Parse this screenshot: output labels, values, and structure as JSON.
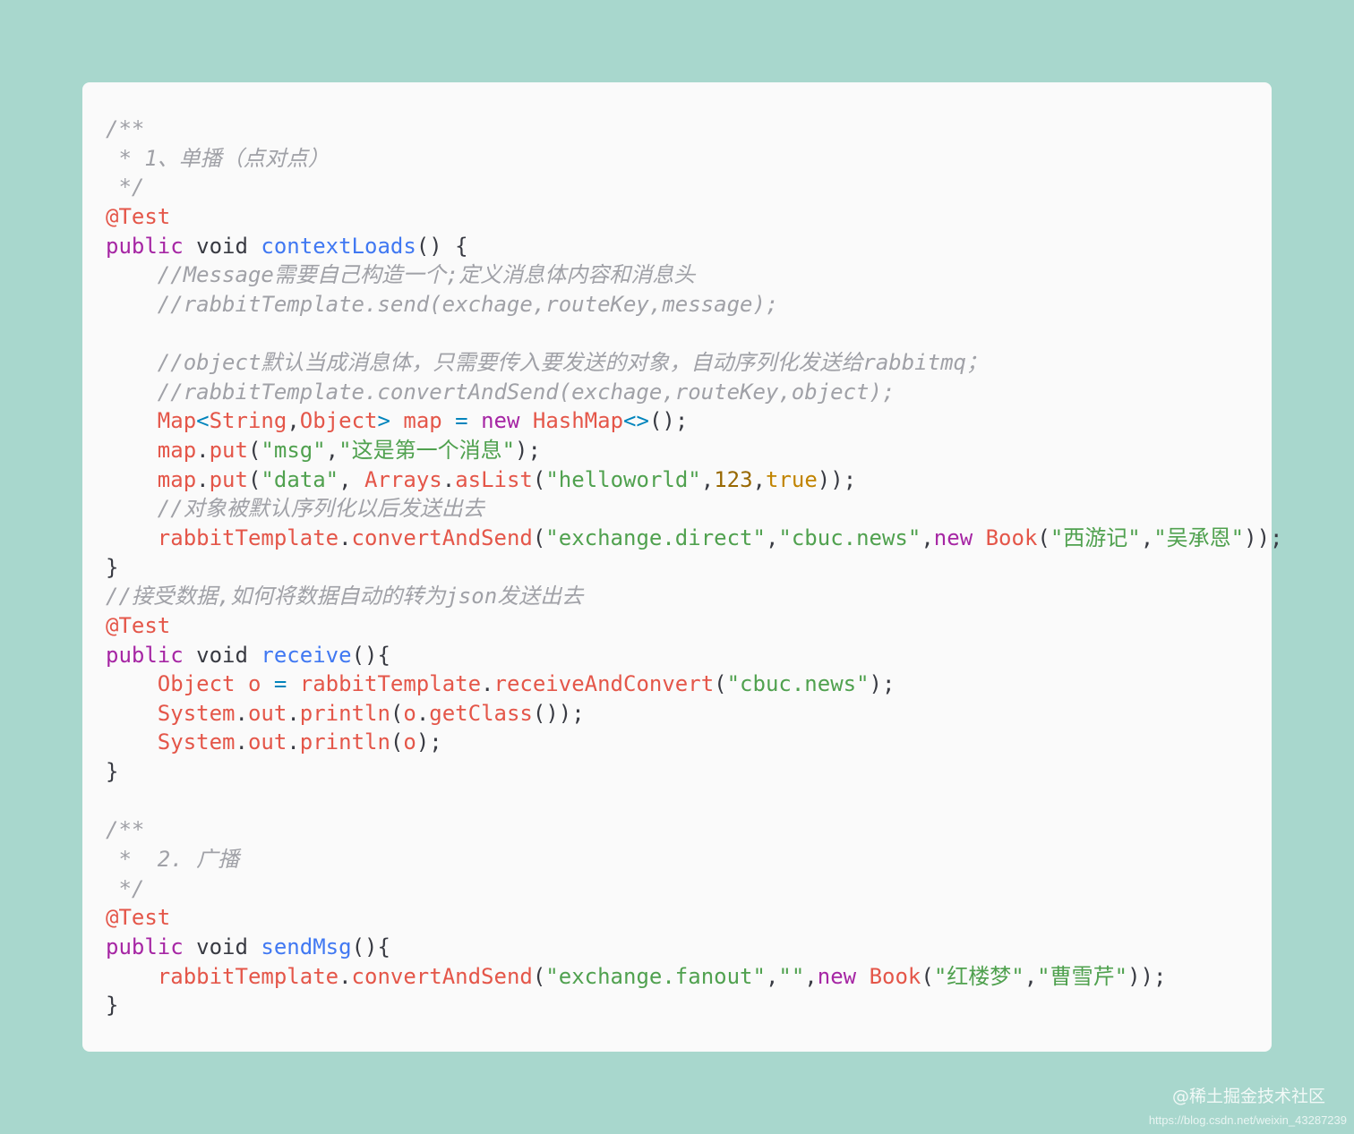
{
  "code": {
    "lines": [
      [
        {
          "t": "/**",
          "c": "comment"
        }
      ],
      [
        {
          "t": " * 1、单播（点对点）",
          "c": "comment"
        }
      ],
      [
        {
          "t": " */",
          "c": "comment"
        }
      ],
      [
        {
          "t": "@Test",
          "c": "annotation"
        }
      ],
      [
        {
          "t": "public",
          "c": "keyword"
        },
        {
          "t": " void ",
          "c": "type"
        },
        {
          "t": "contextLoads",
          "c": "function"
        },
        {
          "t": "() {",
          "c": "punct"
        }
      ],
      [
        {
          "t": "    //Message需要自己构造一个;定义消息体内容和消息头",
          "c": "comment"
        }
      ],
      [
        {
          "t": "    //rabbitTemplate.send(exchage,routeKey,message);",
          "c": "comment"
        }
      ],
      [],
      [
        {
          "t": "    //object默认当成消息体，只需要传入要发送的对象，自动序列化发送给rabbitmq；",
          "c": "comment"
        }
      ],
      [
        {
          "t": "    //rabbitTemplate.convertAndSend(exchage,routeKey,object);",
          "c": "comment"
        }
      ],
      [
        {
          "t": "    ",
          "c": "punct"
        },
        {
          "t": "Map",
          "c": "ident"
        },
        {
          "t": "<",
          "c": "op"
        },
        {
          "t": "String",
          "c": "ident"
        },
        {
          "t": ",",
          "c": "punct"
        },
        {
          "t": "Object",
          "c": "ident"
        },
        {
          "t": ">",
          "c": "op"
        },
        {
          "t": " map ",
          "c": "ident"
        },
        {
          "t": "=",
          "c": "op"
        },
        {
          "t": " new ",
          "c": "keyword"
        },
        {
          "t": "HashMap",
          "c": "ident"
        },
        {
          "t": "<>",
          "c": "op"
        },
        {
          "t": "();",
          "c": "punct"
        }
      ],
      [
        {
          "t": "    ",
          "c": "punct"
        },
        {
          "t": "map",
          "c": "ident"
        },
        {
          "t": ".",
          "c": "punct"
        },
        {
          "t": "put",
          "c": "ident"
        },
        {
          "t": "(",
          "c": "punct"
        },
        {
          "t": "\"msg\"",
          "c": "string"
        },
        {
          "t": ",",
          "c": "punct"
        },
        {
          "t": "\"这是第一个消息\"",
          "c": "string"
        },
        {
          "t": ");",
          "c": "punct"
        }
      ],
      [
        {
          "t": "    ",
          "c": "punct"
        },
        {
          "t": "map",
          "c": "ident"
        },
        {
          "t": ".",
          "c": "punct"
        },
        {
          "t": "put",
          "c": "ident"
        },
        {
          "t": "(",
          "c": "punct"
        },
        {
          "t": "\"data\"",
          "c": "string"
        },
        {
          "t": ", ",
          "c": "punct"
        },
        {
          "t": "Arrays",
          "c": "ident"
        },
        {
          "t": ".",
          "c": "punct"
        },
        {
          "t": "asList",
          "c": "ident"
        },
        {
          "t": "(",
          "c": "punct"
        },
        {
          "t": "\"helloworld\"",
          "c": "string"
        },
        {
          "t": ",",
          "c": "punct"
        },
        {
          "t": "123",
          "c": "number"
        },
        {
          "t": ",",
          "c": "punct"
        },
        {
          "t": "true",
          "c": "literal"
        },
        {
          "t": "));",
          "c": "punct"
        }
      ],
      [
        {
          "t": "    //对象被默认序列化以后发送出去",
          "c": "comment"
        }
      ],
      [
        {
          "t": "    ",
          "c": "punct"
        },
        {
          "t": "rabbitTemplate",
          "c": "ident"
        },
        {
          "t": ".",
          "c": "punct"
        },
        {
          "t": "convertAndSend",
          "c": "ident"
        },
        {
          "t": "(",
          "c": "punct"
        },
        {
          "t": "\"exchange.direct\"",
          "c": "string"
        },
        {
          "t": ",",
          "c": "punct"
        },
        {
          "t": "\"cbuc.news\"",
          "c": "string"
        },
        {
          "t": ",",
          "c": "punct"
        },
        {
          "t": "new",
          "c": "keyword"
        },
        {
          "t": " ",
          "c": "punct"
        },
        {
          "t": "Book",
          "c": "ident"
        },
        {
          "t": "(",
          "c": "punct"
        },
        {
          "t": "\"西游记\"",
          "c": "string"
        },
        {
          "t": ",",
          "c": "punct"
        },
        {
          "t": "\"吴承恩\"",
          "c": "string"
        },
        {
          "t": "));",
          "c": "punct"
        }
      ],
      [
        {
          "t": "}",
          "c": "punct"
        }
      ],
      [
        {
          "t": "//接受数据,如何将数据自动的转为json发送出去",
          "c": "comment"
        }
      ],
      [
        {
          "t": "@Test",
          "c": "annotation"
        }
      ],
      [
        {
          "t": "public",
          "c": "keyword"
        },
        {
          "t": " void ",
          "c": "type"
        },
        {
          "t": "receive",
          "c": "function"
        },
        {
          "t": "(){",
          "c": "punct"
        }
      ],
      [
        {
          "t": "    ",
          "c": "punct"
        },
        {
          "t": "Object o ",
          "c": "ident"
        },
        {
          "t": "=",
          "c": "op"
        },
        {
          "t": " ",
          "c": "punct"
        },
        {
          "t": "rabbitTemplate",
          "c": "ident"
        },
        {
          "t": ".",
          "c": "punct"
        },
        {
          "t": "receiveAndConvert",
          "c": "ident"
        },
        {
          "t": "(",
          "c": "punct"
        },
        {
          "t": "\"cbuc.news\"",
          "c": "string"
        },
        {
          "t": ");",
          "c": "punct"
        }
      ],
      [
        {
          "t": "    ",
          "c": "punct"
        },
        {
          "t": "System",
          "c": "ident"
        },
        {
          "t": ".",
          "c": "punct"
        },
        {
          "t": "out",
          "c": "ident"
        },
        {
          "t": ".",
          "c": "punct"
        },
        {
          "t": "println",
          "c": "ident"
        },
        {
          "t": "(",
          "c": "punct"
        },
        {
          "t": "o",
          "c": "ident"
        },
        {
          "t": ".",
          "c": "punct"
        },
        {
          "t": "getClass",
          "c": "ident"
        },
        {
          "t": "());",
          "c": "punct"
        }
      ],
      [
        {
          "t": "    ",
          "c": "punct"
        },
        {
          "t": "System",
          "c": "ident"
        },
        {
          "t": ".",
          "c": "punct"
        },
        {
          "t": "out",
          "c": "ident"
        },
        {
          "t": ".",
          "c": "punct"
        },
        {
          "t": "println",
          "c": "ident"
        },
        {
          "t": "(",
          "c": "punct"
        },
        {
          "t": "o",
          "c": "ident"
        },
        {
          "t": ");",
          "c": "punct"
        }
      ],
      [
        {
          "t": "}",
          "c": "punct"
        }
      ],
      [],
      [
        {
          "t": "/**",
          "c": "comment"
        }
      ],
      [
        {
          "t": " *  2. 广播",
          "c": "comment"
        }
      ],
      [
        {
          "t": " */",
          "c": "comment"
        }
      ],
      [
        {
          "t": "@Test",
          "c": "annotation"
        }
      ],
      [
        {
          "t": "public",
          "c": "keyword"
        },
        {
          "t": " void ",
          "c": "type"
        },
        {
          "t": "sendMsg",
          "c": "function"
        },
        {
          "t": "(){",
          "c": "punct"
        }
      ],
      [
        {
          "t": "    ",
          "c": "punct"
        },
        {
          "t": "rabbitTemplate",
          "c": "ident"
        },
        {
          "t": ".",
          "c": "punct"
        },
        {
          "t": "convertAndSend",
          "c": "ident"
        },
        {
          "t": "(",
          "c": "punct"
        },
        {
          "t": "\"exchange.fanout\"",
          "c": "string"
        },
        {
          "t": ",",
          "c": "punct"
        },
        {
          "t": "\"\"",
          "c": "string"
        },
        {
          "t": ",",
          "c": "punct"
        },
        {
          "t": "new",
          "c": "keyword"
        },
        {
          "t": " ",
          "c": "punct"
        },
        {
          "t": "Book",
          "c": "ident"
        },
        {
          "t": "(",
          "c": "punct"
        },
        {
          "t": "\"红楼梦\"",
          "c": "string"
        },
        {
          "t": ",",
          "c": "punct"
        },
        {
          "t": "\"曹雪芹\"",
          "c": "string"
        },
        {
          "t": "));",
          "c": "punct"
        }
      ],
      [
        {
          "t": "}",
          "c": "punct"
        }
      ]
    ]
  },
  "watermark": {
    "text": "@稀土掘金技术社区",
    "url": "https://blog.csdn.net/weixin_43287239"
  },
  "colors": {
    "background": "#a8d7cd",
    "card": "#fafafa",
    "comment": "#a0a1a7",
    "keyword": "#a626a4",
    "function": "#4078f2",
    "identifier": "#e45649",
    "string": "#50a14f",
    "number": "#986801",
    "literal": "#c18401",
    "operator": "#0184bc"
  }
}
